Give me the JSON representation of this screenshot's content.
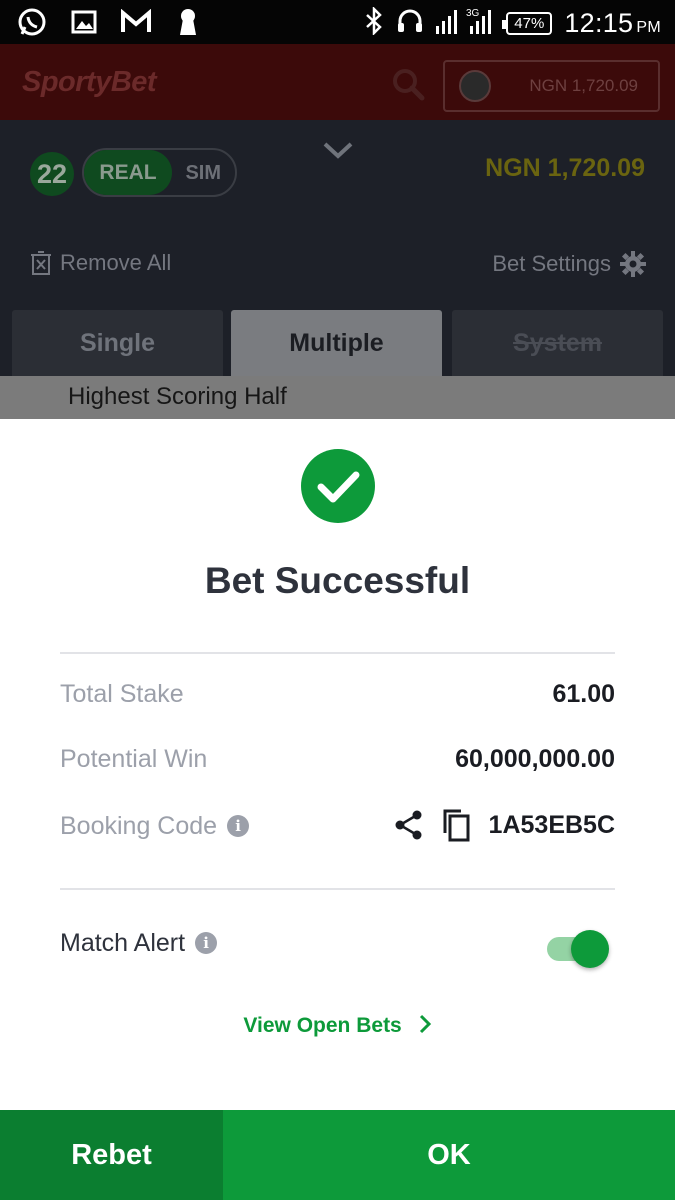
{
  "status_bar": {
    "battery": "47%",
    "network": "3G",
    "time": "12:15",
    "ampm": "PM",
    "icons": [
      "whatsapp-icon",
      "gallery-icon",
      "gmail-icon",
      "keyhole-icon",
      "bluetooth-icon",
      "headset-icon",
      "signal-icon"
    ]
  },
  "header": {
    "logo": "SportyBet",
    "balance": "NGN 1,720.09"
  },
  "betslip": {
    "count": "22",
    "mode_real": "REAL",
    "mode_sim": "SIM",
    "balance": "NGN 1,720.09",
    "remove_all": "Remove All",
    "bet_settings": "Bet Settings",
    "tabs": [
      {
        "label": "Single"
      },
      {
        "label": "Multiple"
      },
      {
        "label": "System"
      }
    ],
    "active_tab": "Multiple",
    "selection": "Highest Scoring Half"
  },
  "modal": {
    "title": "Bet Successful",
    "total_stake_label": "Total Stake",
    "total_stake": "61.00",
    "potential_win_label": "Potential Win",
    "potential_win": "60,000,000.00",
    "booking_code_label": "Booking Code",
    "booking_code": "1A53EB5C",
    "match_alert_label": "Match Alert",
    "match_alert_on": true,
    "view_open_bets": "View Open Bets",
    "rebet": "Rebet",
    "ok": "OK"
  },
  "colors": {
    "accent_green": "#0d9a3a",
    "dark_green": "#0b7e30",
    "title_text": "#2e323c",
    "label_gray": "#9ca0aa"
  }
}
